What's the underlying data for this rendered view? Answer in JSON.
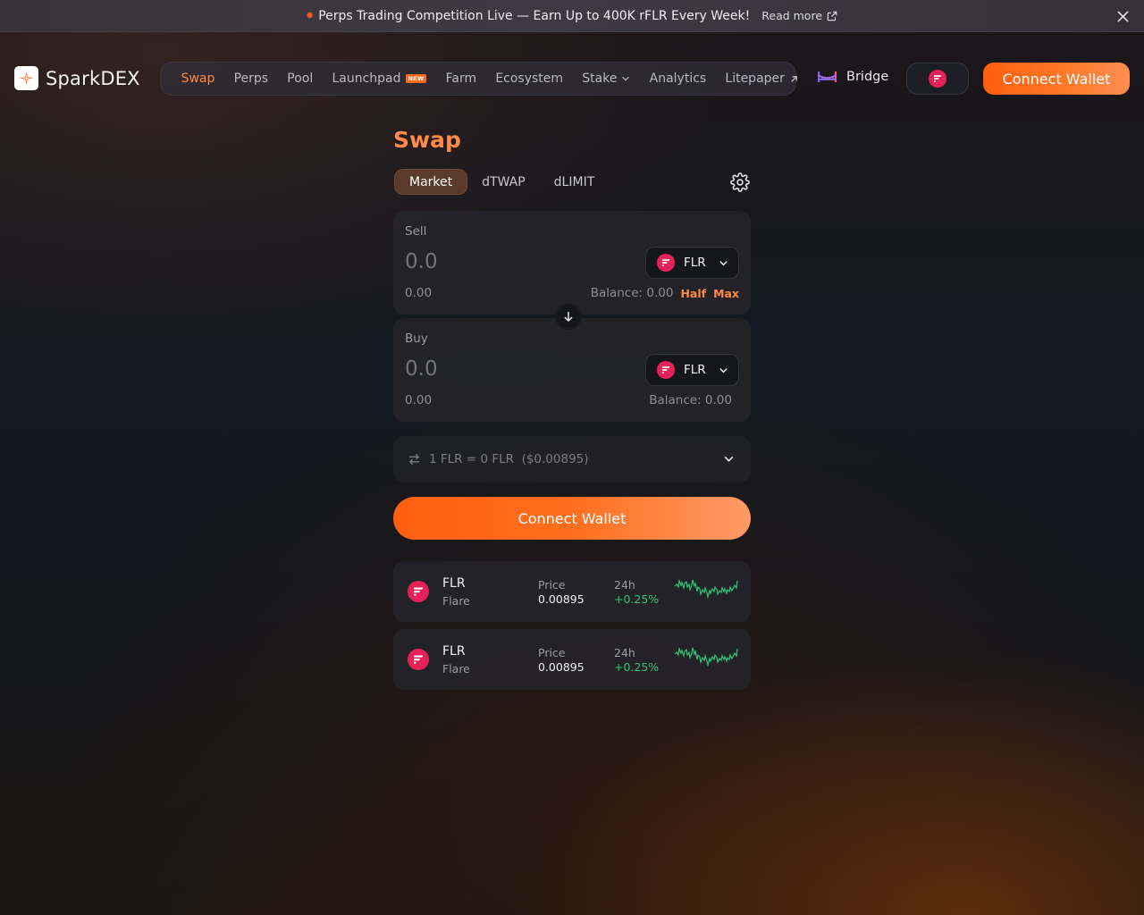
{
  "banner": {
    "text": "Perps Trading Competition Live — Earn Up to 400K rFLR Every Week!",
    "read_more": "Read more"
  },
  "brand": {
    "name": "SparkDEX"
  },
  "nav": {
    "items": [
      {
        "label": "Swap",
        "active": true
      },
      {
        "label": "Perps"
      },
      {
        "label": "Pool"
      },
      {
        "label": "Launchpad",
        "badge": "NEW"
      },
      {
        "label": "Farm"
      },
      {
        "label": "Ecosystem"
      },
      {
        "label": "Stake",
        "dropdown": true
      },
      {
        "label": "Analytics"
      },
      {
        "label": "Litepaper",
        "external": true
      }
    ]
  },
  "header": {
    "bridge_label": "Bridge",
    "connect_wallet": "Connect Wallet"
  },
  "swap": {
    "title": "Swap",
    "tabs": [
      "Market",
      "dTWAP",
      "dLIMIT"
    ],
    "active_tab": "Market",
    "sell": {
      "label": "Sell",
      "amount_placeholder": "0.0",
      "usd_value": "0.00",
      "token": "FLR",
      "balance": "Balance: 0.00",
      "half": "Half",
      "max": "Max"
    },
    "buy": {
      "label": "Buy",
      "amount_placeholder": "0.0",
      "usd_value": "0.00",
      "token": "FLR",
      "balance": "Balance: 0.00"
    },
    "rate": "1 FLR = 0 FLR  ($0.00895)",
    "connect_wallet": "Connect Wallet"
  },
  "token_cards": [
    {
      "symbol": "FLR",
      "name": "Flare",
      "price_label": "Price",
      "price": "0.00895",
      "change_label": "24h",
      "change": "+0.25%"
    },
    {
      "symbol": "FLR",
      "name": "Flare",
      "price_label": "Price",
      "price": "0.00895",
      "change_label": "24h",
      "change": "+0.25%"
    }
  ],
  "colors": {
    "accent": "#ff6a1a",
    "flare_red": "#e62058",
    "positive": "#2ec47a"
  }
}
